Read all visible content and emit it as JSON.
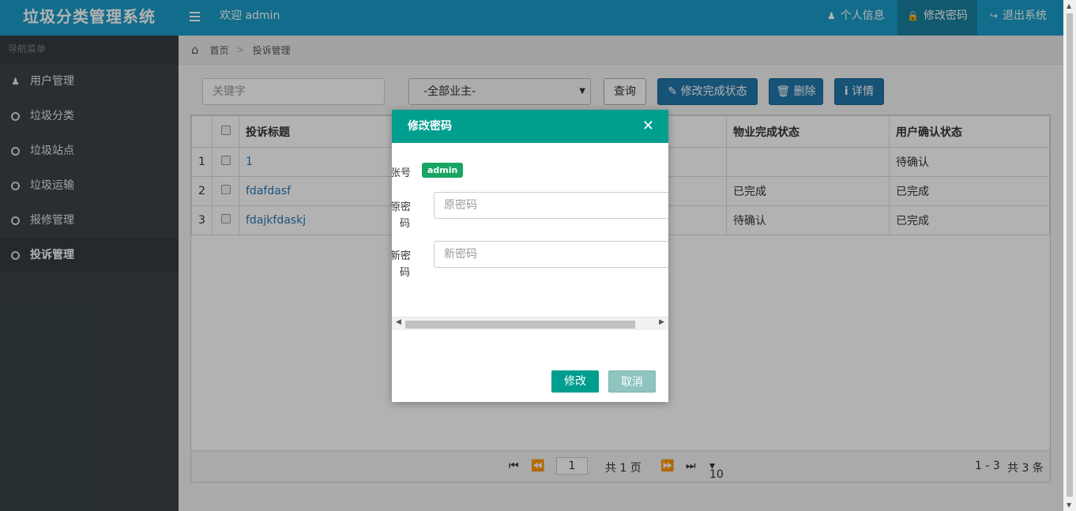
{
  "app": {
    "brand": "垃圾分类管理系统",
    "welcome": "欢迎 admin",
    "nav": {
      "profile": "个人信息",
      "change_password": "修改密码",
      "logout": "退出系统"
    }
  },
  "sidebar": {
    "title": "导航菜单",
    "items": [
      {
        "label": "用户管理",
        "icon": "user-icon"
      },
      {
        "label": "垃圾分类",
        "icon": "circle-icon"
      },
      {
        "label": "垃圾站点",
        "icon": "circle-icon"
      },
      {
        "label": "垃圾运输",
        "icon": "circle-icon"
      },
      {
        "label": "报修管理",
        "icon": "circle-icon"
      },
      {
        "label": "投诉管理",
        "icon": "circle-icon",
        "active": true
      }
    ]
  },
  "breadcrumb": {
    "home": "首页",
    "sep": ">",
    "current": "投诉管理"
  },
  "toolbar": {
    "keyword_placeholder": "关键字",
    "owner_select": "-全部业主-",
    "query": "查询",
    "edit_status": "修改完成状态",
    "delete": "删除",
    "details": "详情"
  },
  "table": {
    "headers": [
      "投诉标题",
      "物业完成状态",
      "用户确认状态"
    ],
    "rows": [
      {
        "num": "1",
        "title": "1",
        "property_status": "",
        "user_status": "待确认"
      },
      {
        "num": "2",
        "title": "fdafdasf",
        "property_status": "已完成",
        "user_status": "已完成"
      },
      {
        "num": "3",
        "title": "fdajkfdaskj",
        "property_status": "待确认",
        "user_status": "已完成"
      }
    ]
  },
  "pager": {
    "page": "1",
    "total_pages": "共 1 页",
    "page_size": "10",
    "range": "1 - 3",
    "total": "共 3 条"
  },
  "modal": {
    "title": "修改密码",
    "account_label": "张号",
    "account_value": "admin",
    "old_pwd_label_1": "原密",
    "old_pwd_label_2": "码",
    "old_pwd_placeholder": "原密码",
    "new_pwd_label_1": "新密",
    "new_pwd_label_2": "码",
    "new_pwd_placeholder": "新密码",
    "submit": "修改",
    "cancel": "取消"
  },
  "colors": {
    "topbar": "#1a9bc7",
    "sidebar": "#3a4348",
    "modal_header": "#009e8f",
    "primary_button": "#2278ab",
    "badge": "#18a564"
  }
}
